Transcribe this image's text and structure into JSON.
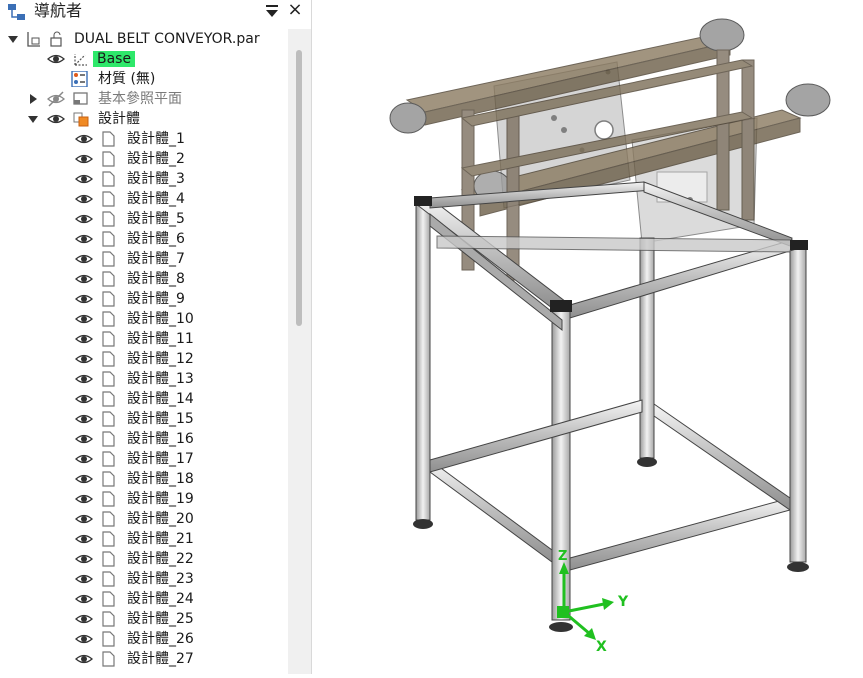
{
  "navigator": {
    "title": "導航者",
    "close": "×"
  },
  "tree": {
    "part_name": "DUAL BELT CONVEYOR.par",
    "base_label": "Base",
    "material_label": "材質 (無)",
    "ref_planes_label": "基本參照平面",
    "design_bodies_label": "設計體",
    "bodies": [
      "設計體_1",
      "設計體_2",
      "設計體_3",
      "設計體_4",
      "設計體_5",
      "設計體_6",
      "設計體_7",
      "設計體_8",
      "設計體_9",
      "設計體_10",
      "設計體_11",
      "設計體_12",
      "設計體_13",
      "設計體_14",
      "設計體_15",
      "設計體_16",
      "設計體_17",
      "設計體_18",
      "設計體_19",
      "設計體_20",
      "設計體_21",
      "設計體_22",
      "設計體_23",
      "設計體_24",
      "設計體_25",
      "設計體_26",
      "設計體_27"
    ]
  },
  "triad": {
    "x": "X",
    "y": "Y",
    "z": "Z"
  },
  "colors": {
    "highlight": "#2ee86a",
    "triad_x": "#20c020",
    "triad_y": "#20c020",
    "triad_z": "#20c020"
  }
}
